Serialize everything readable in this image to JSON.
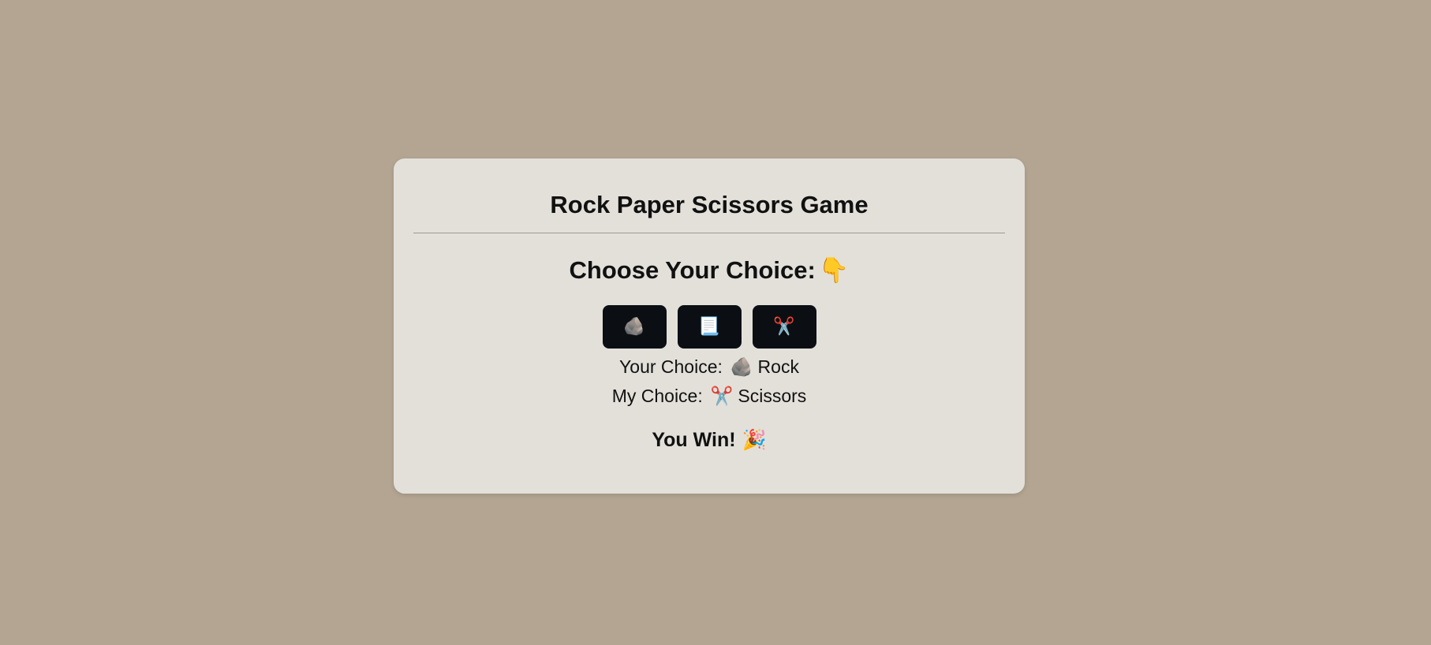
{
  "game": {
    "title": "Rock Paper Scissors Game",
    "prompt": "Choose Your Choice:",
    "prompt_icon": "👇",
    "buttons": [
      {
        "name": "rock",
        "icon": "🪨"
      },
      {
        "name": "paper",
        "icon": "📃"
      },
      {
        "name": "scissors",
        "icon": "✂️"
      }
    ],
    "your_choice_label": "Your Choice:",
    "your_choice_icon": "🪨",
    "your_choice_value": "Rock",
    "my_choice_label": "My Choice:",
    "my_choice_icon": "✂️",
    "my_choice_value": "Scissors",
    "result_text": "You Win!",
    "result_icon": "🎉"
  },
  "colors": {
    "background": "#b3a592",
    "card": "#e3e0da",
    "button": "#0b0f14"
  }
}
